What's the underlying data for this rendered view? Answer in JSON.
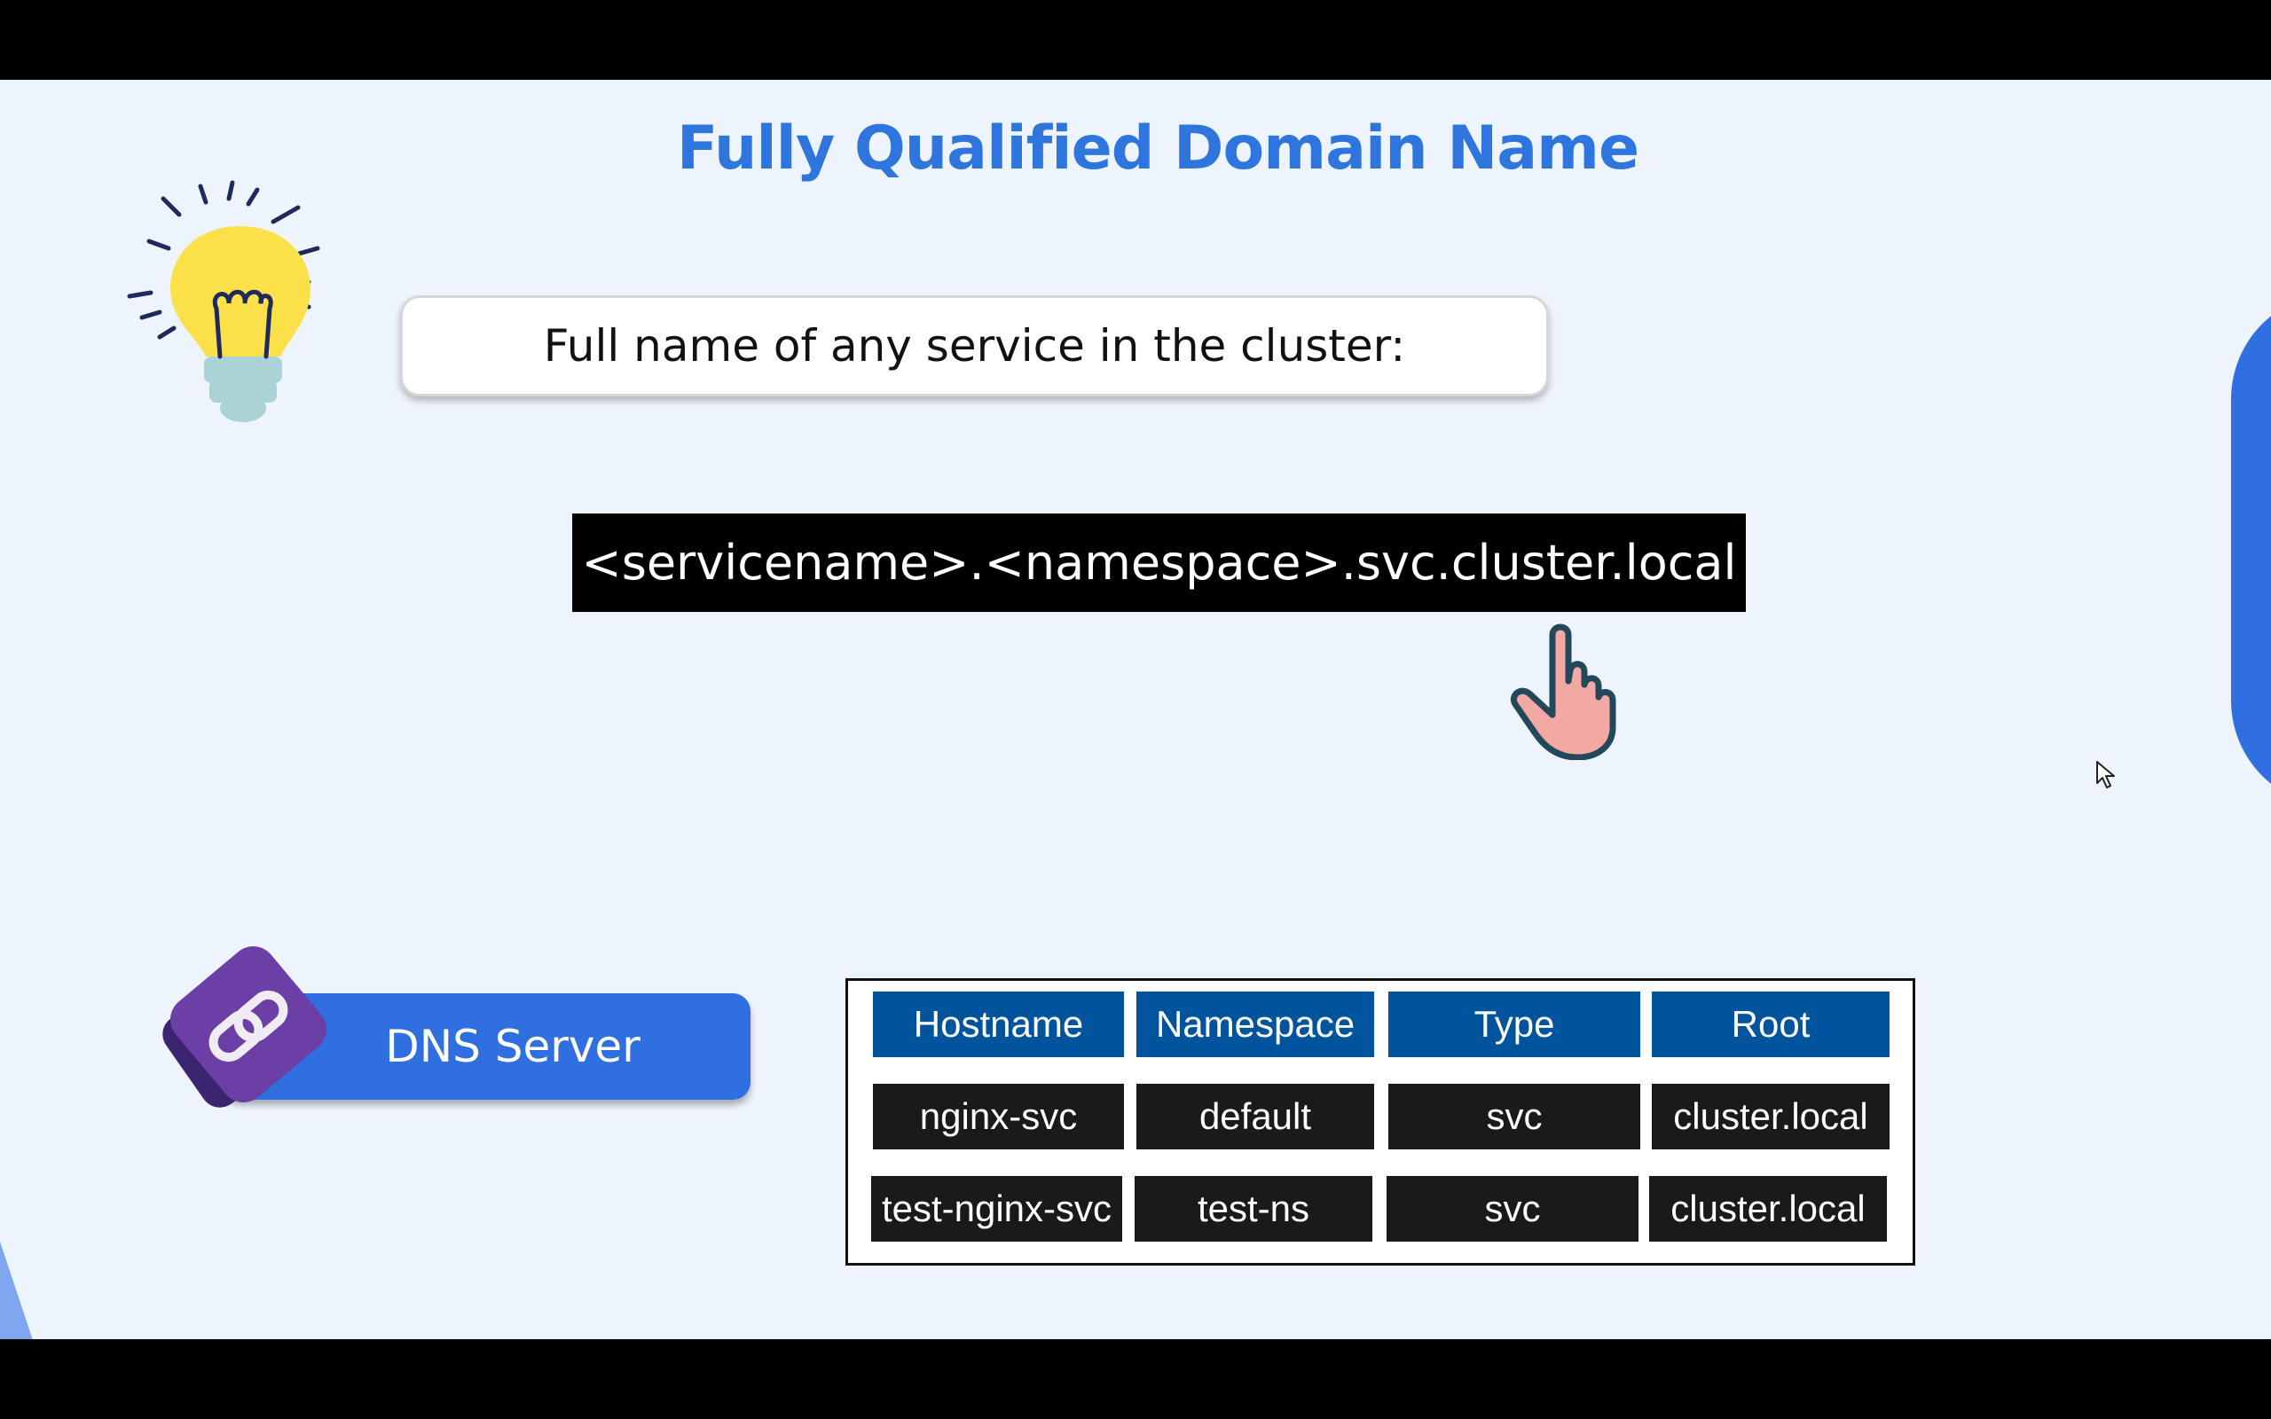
{
  "slide": {
    "title": "Fully Qualified Domain Name",
    "caption": "Full name of any service in the cluster:",
    "fqdn_format": "<servicename>.<namespace>.svc.cluster.local",
    "dns_label": "DNS Server"
  },
  "table": {
    "headers": [
      "Hostname",
      "Namespace",
      "Type",
      "Root"
    ],
    "rows": [
      [
        "nginx-svc",
        "default",
        "svc",
        "cluster.local"
      ],
      [
        "test-nginx-svc",
        "test-ns",
        "svc",
        "cluster.local"
      ]
    ]
  },
  "colors": {
    "accent": "#2e76dd",
    "header_cell": "#00549e",
    "data_cell": "#1a1a1a",
    "slide_bg": "#eef4fe"
  },
  "icons": [
    "lightbulb-icon",
    "pointing-hand-icon",
    "chain-link-icon",
    "mouse-cursor-icon"
  ]
}
